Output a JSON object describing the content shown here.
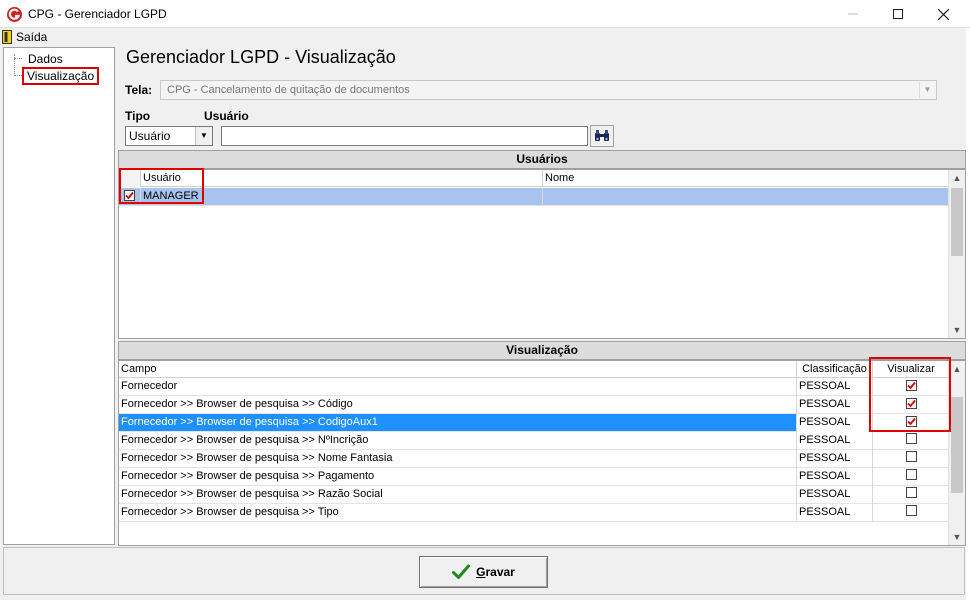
{
  "window": {
    "title": "CPG - Gerenciador LGPD"
  },
  "menu": {
    "saida": "Saída"
  },
  "sidebar": {
    "items": [
      {
        "label": "Dados"
      },
      {
        "label": "Visualização"
      }
    ]
  },
  "page": {
    "title": "Gerenciador LGPD - Visualização"
  },
  "form": {
    "tela_label": "Tela:",
    "tela_value": "CPG - Cancelamento de quitação de documentos",
    "tipo_label": "Tipo",
    "tipo_value": "Usuário",
    "usuario_label": "Usuário",
    "usuario_value": ""
  },
  "usuarios": {
    "header": "Usuários",
    "columns": [
      "Usuário",
      "Nome"
    ],
    "rows": [
      {
        "usuario": "MANAGER",
        "nome": "",
        "checked": true
      }
    ]
  },
  "visualizacao": {
    "header": "Visualização",
    "columns": [
      "Campo",
      "Classificação",
      "Visualizar"
    ],
    "rows": [
      {
        "campo": "Fornecedor",
        "classificacao": "PESSOAL",
        "visualizar": true
      },
      {
        "campo": "Fornecedor >> Browser de pesquisa >> Código",
        "classificacao": "PESSOAL",
        "visualizar": true
      },
      {
        "campo": "Fornecedor >> Browser de pesquisa >> CodigoAux1",
        "classificacao": "PESSOAL",
        "visualizar": true
      },
      {
        "campo": "Fornecedor >> Browser de pesquisa >> NºIncrição",
        "classificacao": "PESSOAL",
        "visualizar": false
      },
      {
        "campo": "Fornecedor >> Browser de pesquisa >> Nome Fantasia",
        "classificacao": "PESSOAL",
        "visualizar": false
      },
      {
        "campo": "Fornecedor >> Browser de pesquisa >> Pagamento",
        "classificacao": "PESSOAL",
        "visualizar": false
      },
      {
        "campo": "Fornecedor >> Browser de pesquisa >> Razão Social",
        "classificacao": "PESSOAL",
        "visualizar": false
      },
      {
        "campo": "Fornecedor >> Browser de pesquisa >> Tipo",
        "classificacao": "PESSOAL",
        "visualizar": false
      }
    ]
  },
  "actions": {
    "gravar_prefix": "G",
    "gravar_rest": "ravar"
  },
  "colors": {
    "selection_blue": "#1e90ff",
    "selection_light": "#a8c4ee",
    "highlight_red": "#e00000",
    "check_red": "#d40000",
    "check_green": "#1a8a1a"
  }
}
